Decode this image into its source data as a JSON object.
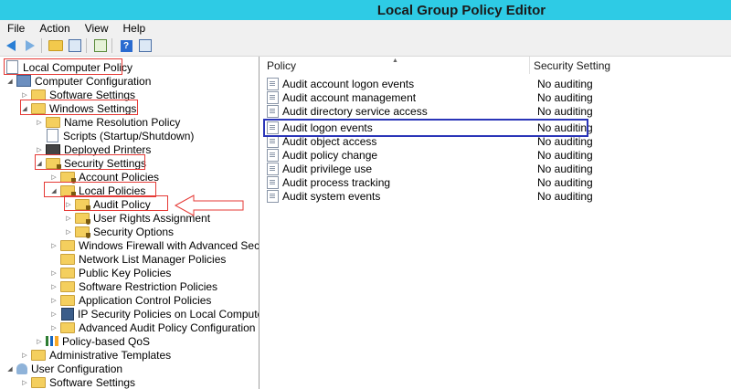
{
  "window": {
    "title": "Local Group Policy Editor"
  },
  "menu": [
    "File",
    "Action",
    "View",
    "Help"
  ],
  "toolbar": [
    "back-icon",
    "forward-icon",
    "up-folder-icon",
    "show-hide-tree-icon",
    "export-list-icon",
    "help-icon",
    "properties-icon"
  ],
  "tree": [
    {
      "label": "Local Computer Policy"
    },
    {
      "label": "Computer Configuration"
    },
    {
      "label": "Software Settings"
    },
    {
      "label": "Windows Settings"
    },
    {
      "label": "Name Resolution Policy"
    },
    {
      "label": "Scripts (Startup/Shutdown)"
    },
    {
      "label": "Deployed Printers"
    },
    {
      "label": "Security Settings"
    },
    {
      "label": "Account Policies"
    },
    {
      "label": "Local Policies"
    },
    {
      "label": "Audit Policy"
    },
    {
      "label": "User Rights Assignment"
    },
    {
      "label": "Security Options"
    },
    {
      "label": "Windows Firewall with Advanced Security"
    },
    {
      "label": "Network List Manager Policies"
    },
    {
      "label": "Public Key Policies"
    },
    {
      "label": "Software Restriction Policies"
    },
    {
      "label": "Application Control Policies"
    },
    {
      "label": "IP Security Policies on Local Computer"
    },
    {
      "label": "Advanced Audit Policy Configuration"
    },
    {
      "label": "Policy-based QoS"
    },
    {
      "label": "Administrative Templates"
    },
    {
      "label": "User Configuration"
    },
    {
      "label": "Software Settings"
    }
  ],
  "list": {
    "columns": {
      "policy": "Policy",
      "setting": "Security Setting"
    },
    "rows": [
      {
        "policy": "Audit account logon events",
        "setting": "No auditing"
      },
      {
        "policy": "Audit account management",
        "setting": "No auditing"
      },
      {
        "policy": "Audit directory service access",
        "setting": "No auditing"
      },
      {
        "policy": "Audit logon events",
        "setting": "No auditing"
      },
      {
        "policy": "Audit object access",
        "setting": "No auditing"
      },
      {
        "policy": "Audit policy change",
        "setting": "No auditing"
      },
      {
        "policy": "Audit privilege use",
        "setting": "No auditing"
      },
      {
        "policy": "Audit process tracking",
        "setting": "No auditing"
      },
      {
        "policy": "Audit system events",
        "setting": "No auditing"
      }
    ]
  },
  "colors": {
    "titlebar": "#2ecbe5",
    "annotation_red": "#e53935",
    "annotation_blue": "#2a35b8"
  }
}
